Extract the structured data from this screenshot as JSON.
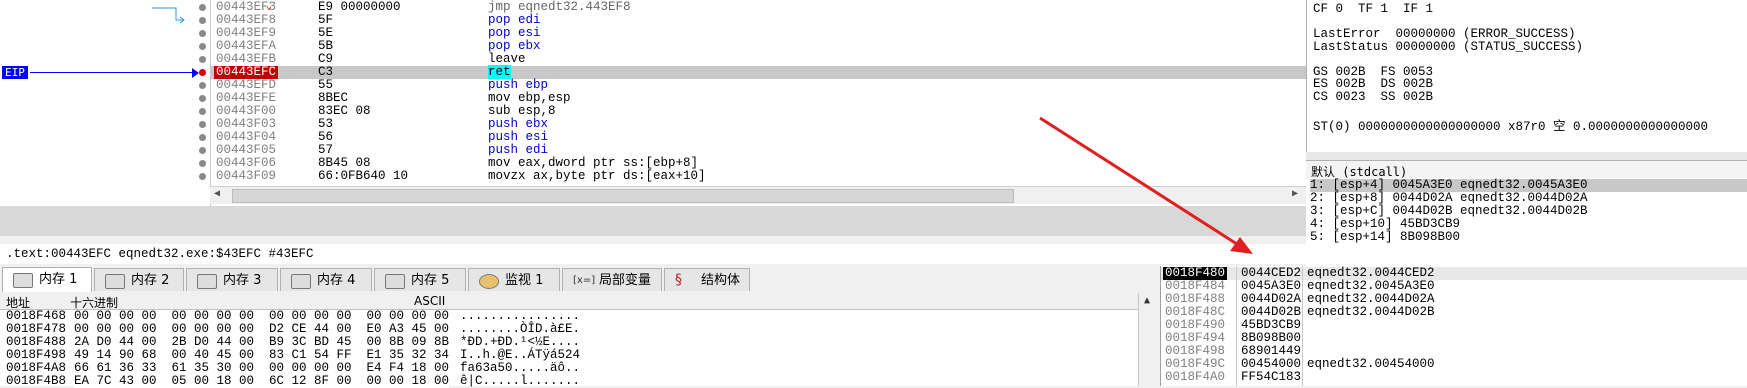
{
  "disassembly": {
    "rows": [
      {
        "addr": "00443EF3",
        "bytes": "E9 00000000",
        "asm_mnem": "jmp",
        "asm_ops": "eqnedt32.443EF8",
        "type": "jmp"
      },
      {
        "addr": "00443EF8",
        "bytes": "5F",
        "asm_mnem": "pop",
        "asm_ops": "edi",
        "type": "kw"
      },
      {
        "addr": "00443EF9",
        "bytes": "5E",
        "asm_mnem": "pop",
        "asm_ops": "esi",
        "type": "kw"
      },
      {
        "addr": "00443EFA",
        "bytes": "5B",
        "asm_mnem": "pop",
        "asm_ops": "ebx",
        "type": "kw"
      },
      {
        "addr": "00443EFB",
        "bytes": "C9",
        "asm_mnem": "leave",
        "asm_ops": "",
        "type": "plain"
      },
      {
        "addr": "00443EFC",
        "bytes": "C3",
        "asm_mnem": "ret",
        "asm_ops": "",
        "type": "ret"
      },
      {
        "addr": "00443EFD",
        "bytes": "55",
        "asm_mnem": "push",
        "asm_ops": "ebp",
        "type": "kw"
      },
      {
        "addr": "00443EFE",
        "bytes": "8BEC",
        "asm_mnem": "mov",
        "asm_ops": "ebp,esp",
        "type": "plain"
      },
      {
        "addr": "00443F00",
        "bytes": "83EC 08",
        "asm_mnem": "sub",
        "asm_ops": "esp,8",
        "type": "plain"
      },
      {
        "addr": "00443F03",
        "bytes": "53",
        "asm_mnem": "push",
        "asm_ops": "ebx",
        "type": "kw"
      },
      {
        "addr": "00443F04",
        "bytes": "56",
        "asm_mnem": "push",
        "asm_ops": "esi",
        "type": "kw"
      },
      {
        "addr": "00443F05",
        "bytes": "57",
        "asm_mnem": "push",
        "asm_ops": "edi",
        "type": "kw"
      },
      {
        "addr": "00443F06",
        "bytes": "8B45 08",
        "asm_mnem": "mov",
        "asm_ops": "eax,dword ptr ss:[ebp+8]",
        "type": "mem"
      },
      {
        "addr": "00443F09",
        "bytes": "66:0FB640 10",
        "asm_mnem": "movzx",
        "asm_ops": "ax,byte ptr ds:[eax+10]",
        "type": "mem"
      }
    ],
    "eip_label": "EIP",
    "jump_marker": "⌄"
  },
  "info_line": ".text:00443EFC eqnedt32.exe:$43EFC #43EFC",
  "registers": {
    "lines": [
      "CF 0  TF 1  IF 1",
      "",
      "LastError  00000000 (ERROR_SUCCESS)",
      "LastStatus 00000000 (STATUS_SUCCESS)",
      "",
      "GS 002B  FS 0053",
      "ES 002B  DS 002B",
      "CS 0023  SS 002B",
      "",
      "ST(0) 0000000000000000000 x87r0 空 0.0000000000000000"
    ]
  },
  "callconv": {
    "label": "默认 (stdcall)",
    "lines": [
      "1: [esp+4] 0045A3E0 eqnedt32.0045A3E0",
      "2: [esp+8] 0044D02A eqnedt32.0044D02A",
      "3: [esp+C] 0044D02B eqnedt32.0044D02B",
      "4: [esp+10] 45BD3CB9",
      "5: [esp+14] 8B098B00"
    ]
  },
  "tabs": [
    {
      "label": "内存 1",
      "icon": "memory-icon"
    },
    {
      "label": "内存 2",
      "icon": "memory-icon"
    },
    {
      "label": "内存 3",
      "icon": "memory-icon"
    },
    {
      "label": "内存 4",
      "icon": "memory-icon"
    },
    {
      "label": "内存 5",
      "icon": "memory-icon"
    },
    {
      "label": "监视 1",
      "icon": "watch-icon"
    },
    {
      "label": "局部变量",
      "icon": "variable-icon"
    },
    {
      "label": "结构体",
      "icon": "struct-icon"
    }
  ],
  "dump": {
    "col_addr": "地址",
    "col_hex": "十六进制",
    "col_ascii": "ASCII",
    "rows": [
      {
        "addr": "0018F468",
        "hex": "00 00 00 00  00 00 00 00  00 00 00 00  00 00 00 00",
        "ascii": "................"
      },
      {
        "addr": "0018F478",
        "hex": "00 00 00 00  00 00 00 00  D2 CE 44 00  E0 A3 45 00",
        "ascii": "........ÒÎD.à£E."
      },
      {
        "addr": "0018F488",
        "hex": "2A D0 44 00  2B D0 44 00  B9 3C BD 45  00 8B 09 8B",
        "ascii": "*ÐD.+ÐD.¹<½E...."
      },
      {
        "addr": "0018F498",
        "hex": "49 14 90 68  00 40 45 00  83 C1 54 FF  E1 35 32 34",
        "ascii": "I..h.@E..ÁTÿá524"
      },
      {
        "addr": "0018F4A8",
        "hex": "66 61 36 33  61 35 30 00  00 00 00 00  E4 F4 18 00",
        "ascii": "fa63a50.....äô.."
      },
      {
        "addr": "0018F4B8",
        "hex": "EA 7C 43 00  05 00 18 00  6C 12 8F 00  00 00 18 00",
        "ascii": "ê|C.....l......."
      }
    ]
  },
  "stack": {
    "rows": [
      {
        "addr": "0018F480",
        "val": "0044CED2",
        "comment": "eqnedt32.0044CED2"
      },
      {
        "addr": "0018F484",
        "val": "0045A3E0",
        "comment": "eqnedt32.0045A3E0"
      },
      {
        "addr": "0018F488",
        "val": "0044D02A",
        "comment": "eqnedt32.0044D02A"
      },
      {
        "addr": "0018F48C",
        "val": "0044D02B",
        "comment": "eqnedt32.0044D02B"
      },
      {
        "addr": "0018F490",
        "val": "45BD3CB9",
        "comment": ""
      },
      {
        "addr": "0018F494",
        "val": "8B098B00",
        "comment": ""
      },
      {
        "addr": "0018F498",
        "val": "68901449",
        "comment": ""
      },
      {
        "addr": "0018F49C",
        "val": "00454000",
        "comment": "eqnedt32.00454000"
      },
      {
        "addr": "0018F4A0",
        "val": "FF54C183",
        "comment": ""
      }
    ]
  },
  "colors": {
    "eip": "#0000ff",
    "breakpoint": "#e00000",
    "annotation_arrow": "#e02020",
    "highlight": "#00ffff"
  }
}
